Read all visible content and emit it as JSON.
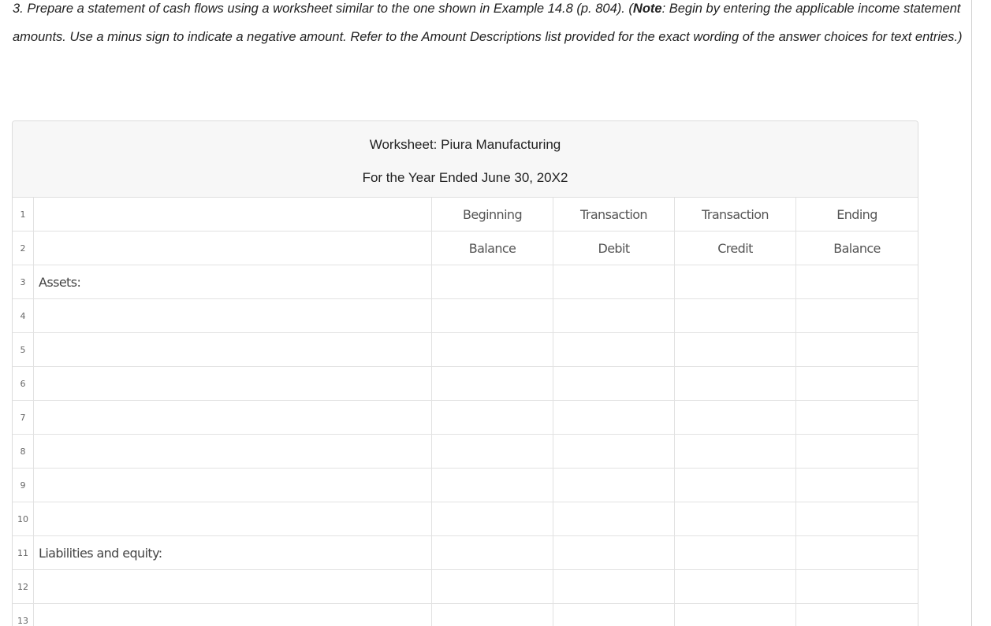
{
  "instructions": {
    "part1": "3. Prepare a statement of cash flows using a worksheet similar to the one shown in Example 14.8 (p. 804). (",
    "note_label": "Note",
    "part2": ": Begin by entering the applicable income statement amounts. Use a minus sign to indicate a negative amount. Refer to the Amount Descriptions list provided for the exact wording of the answer choices for text entries.)"
  },
  "worksheet": {
    "title": "Worksheet: Piura Manufacturing",
    "subtitle": "For the Year Ended June 30, 20X2",
    "rows": [
      {
        "num": "1",
        "label": "",
        "c1": "Beginning",
        "c2": "Transaction",
        "c3": "Transaction",
        "c4": "Ending"
      },
      {
        "num": "2",
        "label": "",
        "c1": "Balance",
        "c2": "Debit",
        "c3": "Credit",
        "c4": "Balance"
      },
      {
        "num": "3",
        "label": "Assets:",
        "c1": "",
        "c2": "",
        "c3": "",
        "c4": ""
      },
      {
        "num": "4",
        "label": "",
        "c1": "",
        "c2": "",
        "c3": "",
        "c4": ""
      },
      {
        "num": "5",
        "label": "",
        "c1": "",
        "c2": "",
        "c3": "",
        "c4": ""
      },
      {
        "num": "6",
        "label": "",
        "c1": "",
        "c2": "",
        "c3": "",
        "c4": ""
      },
      {
        "num": "7",
        "label": "",
        "c1": "",
        "c2": "",
        "c3": "",
        "c4": ""
      },
      {
        "num": "8",
        "label": "",
        "c1": "",
        "c2": "",
        "c3": "",
        "c4": ""
      },
      {
        "num": "9",
        "label": "",
        "c1": "",
        "c2": "",
        "c3": "",
        "c4": ""
      },
      {
        "num": "10",
        "label": "",
        "c1": "",
        "c2": "",
        "c3": "",
        "c4": ""
      },
      {
        "num": "11",
        "label": "Liabilities and equity:",
        "c1": "",
        "c2": "",
        "c3": "",
        "c4": ""
      },
      {
        "num": "12",
        "label": "",
        "c1": "",
        "c2": "",
        "c3": "",
        "c4": ""
      },
      {
        "num": "13",
        "label": "",
        "c1": "",
        "c2": "",
        "c3": "",
        "c4": ""
      }
    ]
  }
}
